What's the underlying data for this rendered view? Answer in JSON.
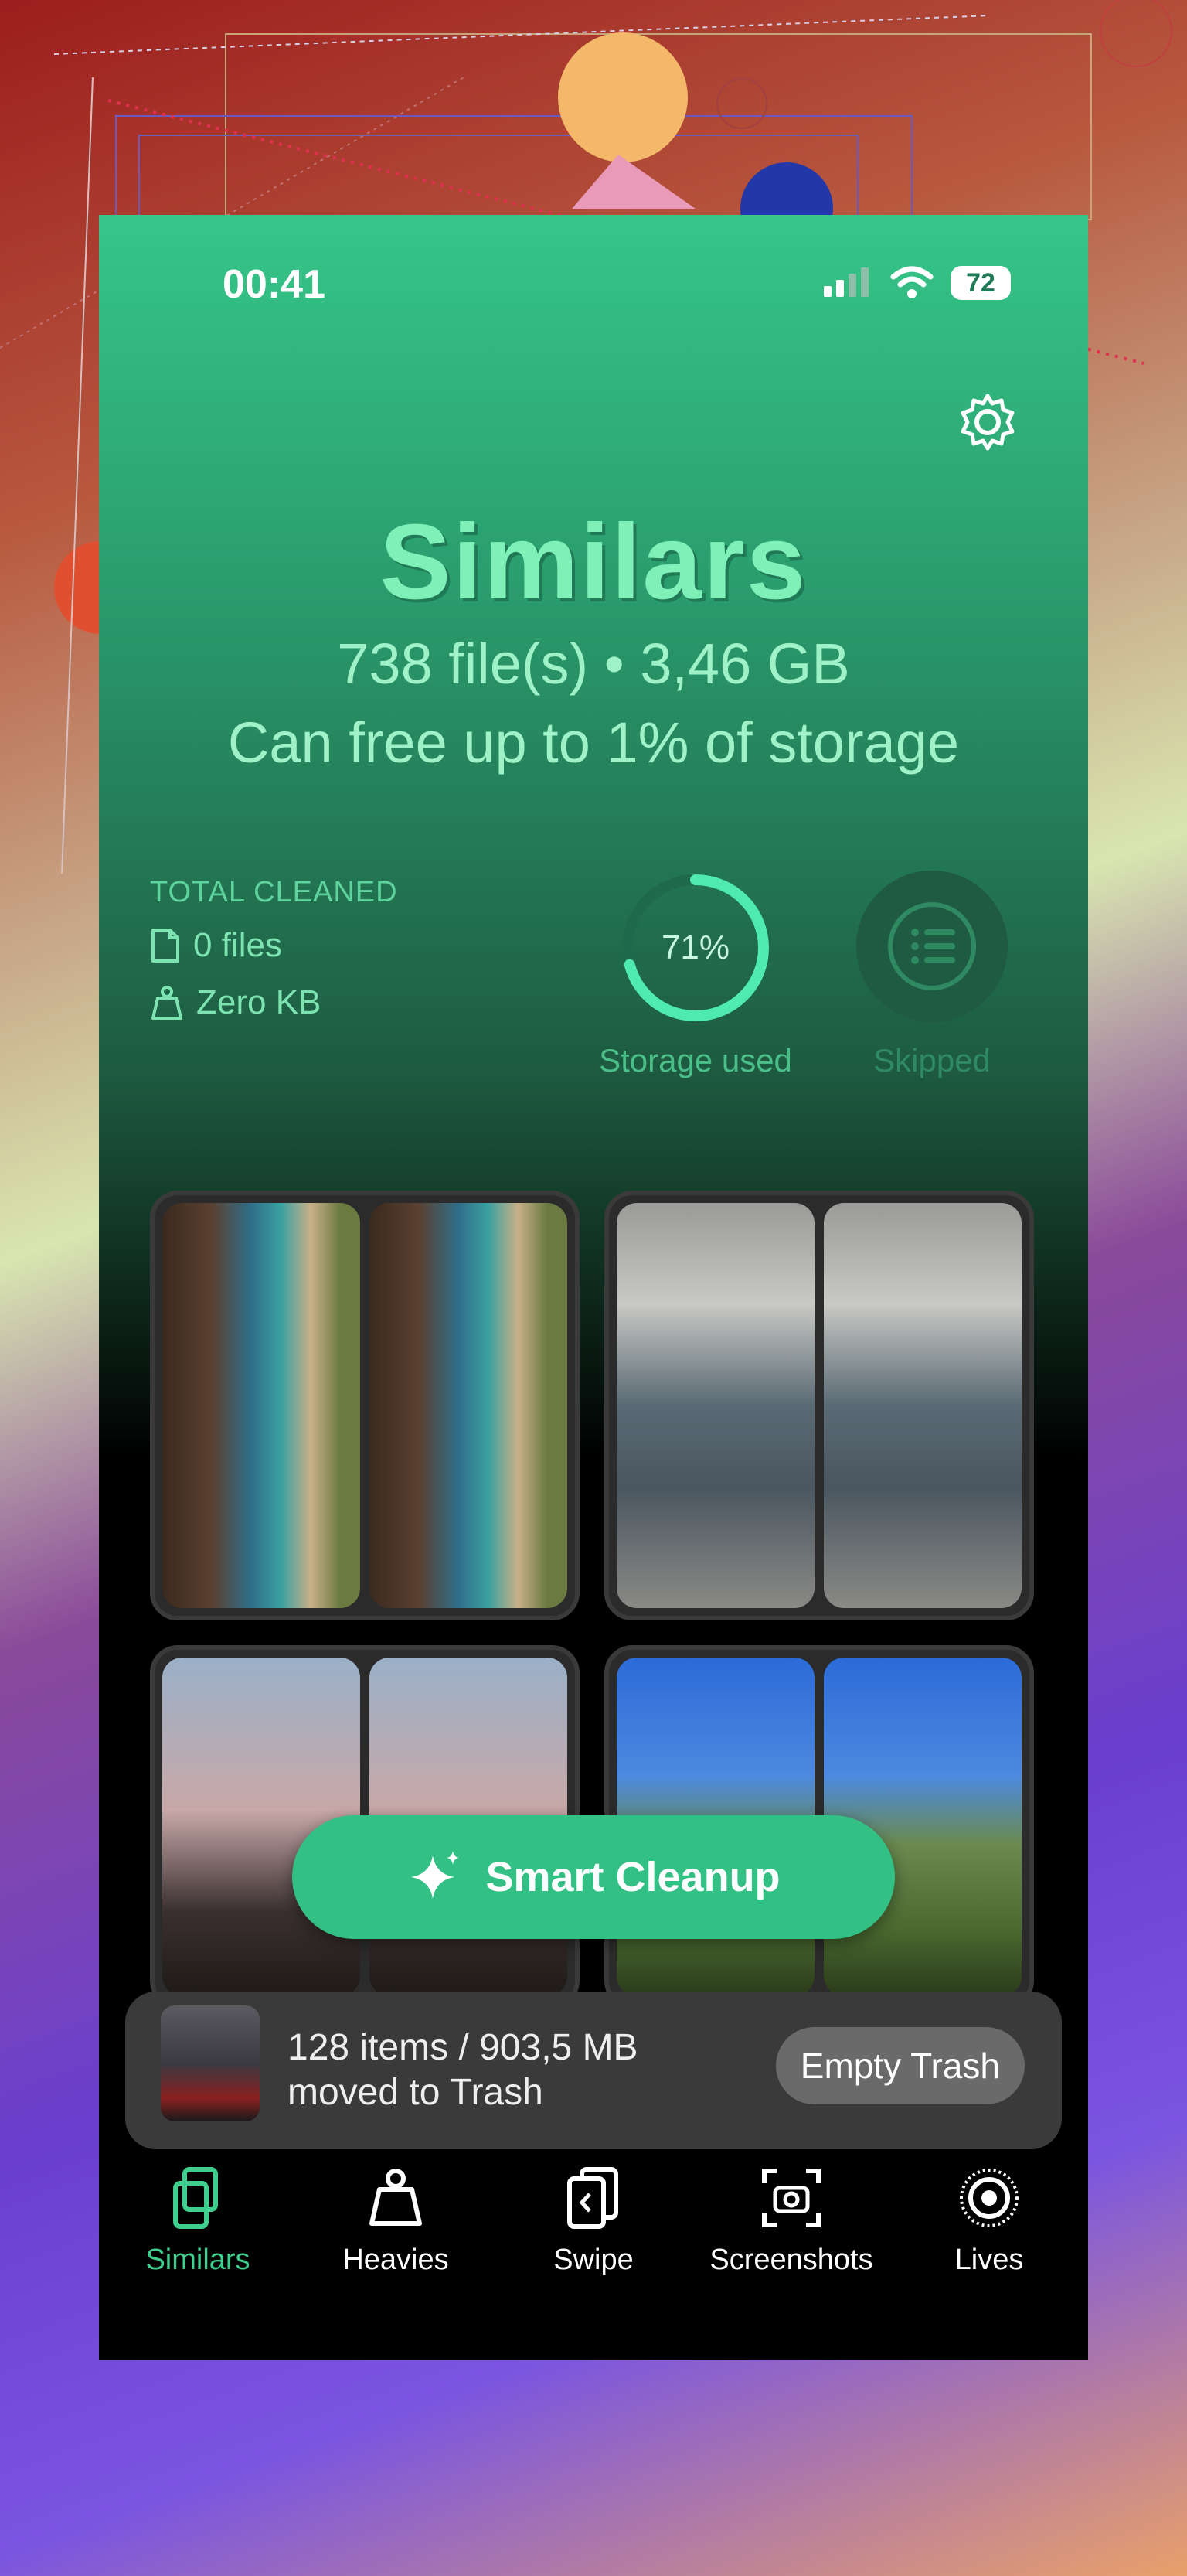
{
  "status": {
    "time": "00:41",
    "battery": "72"
  },
  "header": {
    "title": "Similars",
    "summary": "738 file(s) • 3,46 GB",
    "free_text": "Can free up to 1% of storage"
  },
  "total_cleaned": {
    "label": "TOTAL CLEANED",
    "files": "0 files",
    "size": "Zero KB"
  },
  "storage": {
    "percent_text": "71%",
    "percent_value": 71,
    "label": "Storage used"
  },
  "skipped": {
    "label": "Skipped"
  },
  "fab": {
    "label": "Smart Cleanup"
  },
  "trash": {
    "line1": "128 items / 903,5 MB",
    "line2": "moved to Trash",
    "button": "Empty Trash"
  },
  "tabs": [
    {
      "label": "Similars",
      "icon": "similars-icon",
      "active": true
    },
    {
      "label": "Heavies",
      "icon": "weight-icon",
      "active": false
    },
    {
      "label": "Swipe",
      "icon": "swipe-icon",
      "active": false
    },
    {
      "label": "Screenshots",
      "icon": "screenshot-icon",
      "active": false
    },
    {
      "label": "Lives",
      "icon": "live-icon",
      "active": false
    }
  ],
  "colors": {
    "accent": "#33c085",
    "title": "#7ef0b8",
    "text": "#9ff2c8"
  }
}
